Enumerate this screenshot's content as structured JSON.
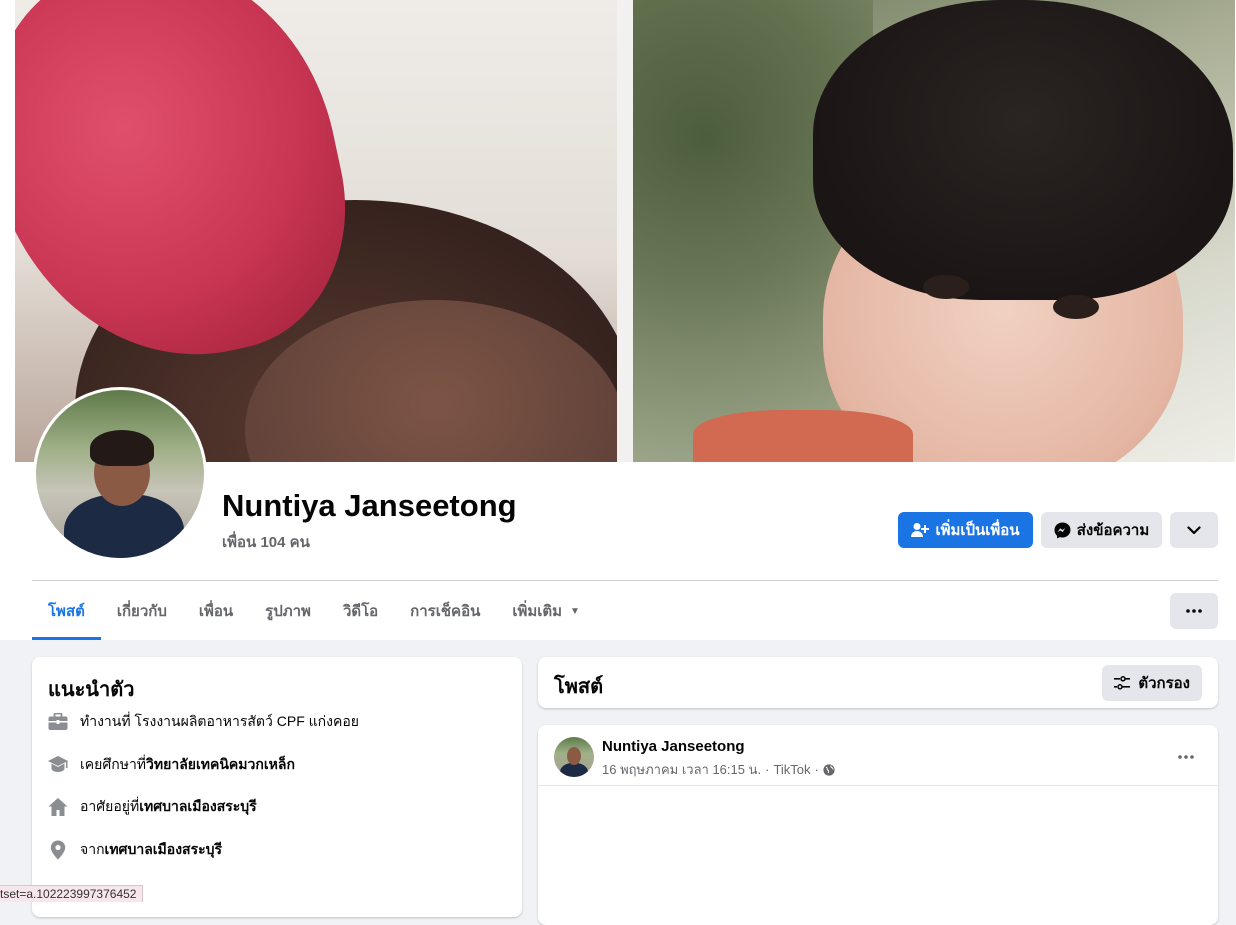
{
  "profile": {
    "name": "Nuntiya Janseetong",
    "friends": "เพื่อน 104 คน"
  },
  "actions": {
    "add_friend": "เพิ่มเป็นเพื่อน",
    "message": "ส่งข้อความ"
  },
  "tabs": [
    {
      "label": "โพสต์",
      "active": true
    },
    {
      "label": "เกี่ยวกับ"
    },
    {
      "label": "เพื่อน"
    },
    {
      "label": "รูปภาพ"
    },
    {
      "label": "วิดีโอ"
    },
    {
      "label": "การเช็คอิน"
    },
    {
      "label": "เพิ่มเติม"
    }
  ],
  "intro": {
    "title": "แนะนำตัว",
    "work": "ทำงานที่ โรงงานผลิตอาหารสัตว์ CPF แก่งคอย",
    "education_prefix": "เคยศึกษาที่ ",
    "education_place": "วิทยาลัยเทคนิคมวกเหล็ก",
    "lives_prefix": "อาศัยอยู่ที่ ",
    "lives_place": "เทศบาลเมืองสระบุรี",
    "from_prefix": "จาก ",
    "from_place": "เทศบาลเมืองสระบุรี"
  },
  "posts": {
    "title": "โพสต์",
    "filter_label": "ตัวกรอง"
  },
  "post": {
    "author": "Nuntiya Janseetong",
    "date": "16 พฤษภาคม เวลา 16:15 น.",
    "source": "TikTok"
  },
  "status_url": "tset=a.102223997376452",
  "colors": {
    "accent": "#1b74e4",
    "background": "#f0f2f5",
    "secondary_button": "#e4e6eb",
    "secondary_text": "#65676b"
  }
}
